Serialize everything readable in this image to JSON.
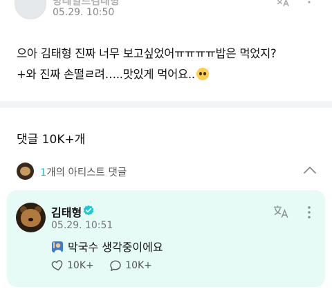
{
  "post": {
    "author": "방레일르김태형",
    "date": "05.29. 10:50",
    "line1": "으아 김태형 진짜 너무 보고싶었어ㅠㅠㅠㅠ밥은 먹었지?",
    "line2": "+와 진짜 손떨ㄹ려…..맛있게 먹어요..",
    "line2_emoji": "pleading-face-emoji"
  },
  "comments_header": {
    "count_label": "댓글 10K+개"
  },
  "artist_comments": {
    "count": "1",
    "label_suffix": "개의 아티스트 댓글"
  },
  "comment": {
    "author": "김태형",
    "date": "05.29. 10:51",
    "emoji": "person-raising-hand-emoji",
    "text": "막국수 생각중이에요",
    "likes": "10K+",
    "replies": "10K+"
  },
  "colors": {
    "accent": "#1fbec9",
    "card_bg": "#e6fbf6",
    "divider": "#f3f4f6"
  }
}
